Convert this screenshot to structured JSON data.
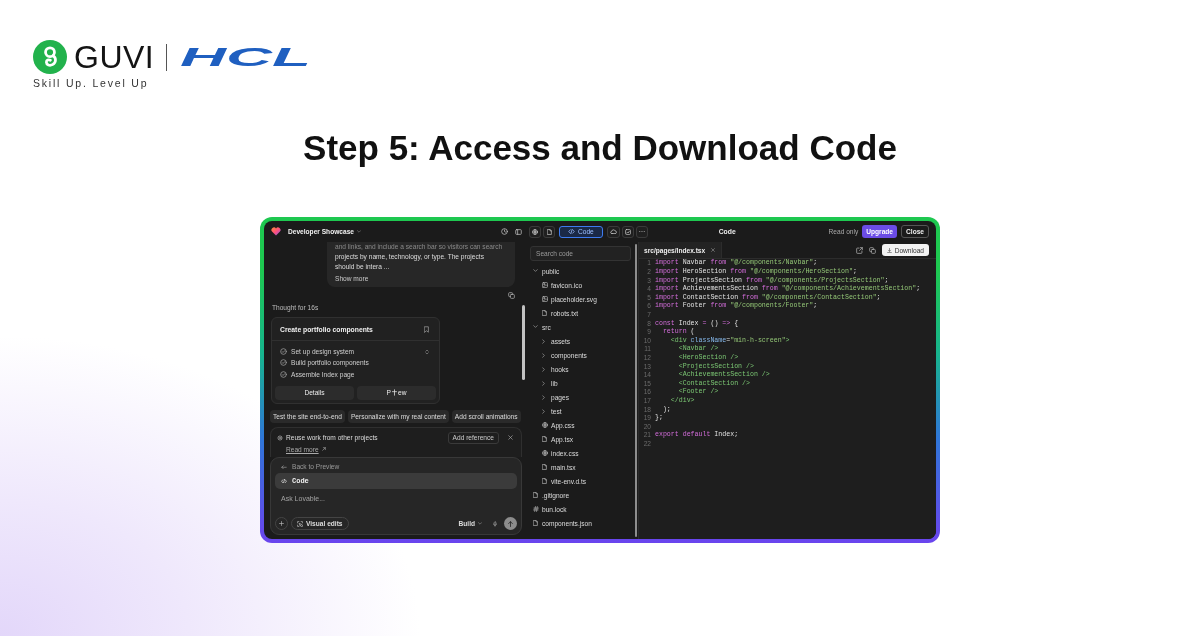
{
  "brand": {
    "name": "GUVI",
    "partner": "HCL",
    "tagline": "Skill Up. Level Up"
  },
  "heading": "Step 5: Access and Download Code",
  "app": {
    "header": {
      "project": "Developer Showcase",
      "views": [
        {
          "kind": "globe",
          "selected": false
        },
        {
          "kind": "file",
          "selected": false
        },
        {
          "kind": "code",
          "label": "Code",
          "selected": true
        },
        {
          "kind": "cloud",
          "selected": false
        },
        {
          "kind": "chart",
          "selected": false
        }
      ],
      "title": "Code",
      "status": "Read only",
      "buttons": [
        {
          "kind": "primary",
          "label": "Upgrade"
        },
        {
          "kind": "secondary",
          "label": "Close"
        }
      ]
    },
    "chat": {
      "message": {
        "lines": [
          "and links, and include a search bar so visitors can search",
          "projects by name, technology, or type. The projects",
          "should be intera ..."
        ],
        "more": "Show more"
      },
      "thought": "Thought for 16s",
      "plan": {
        "title": "Create portfolio components",
        "steps": [
          {
            "label": "Set up design system",
            "done": true
          },
          {
            "label": "Build portfolio components",
            "done": true
          },
          {
            "label": "Assemble Index page",
            "done": true
          }
        ],
        "actions": [
          {
            "label": "Details"
          },
          {
            "label": "P",
            "label_after_cursor": "ew"
          }
        ]
      },
      "suggestions": [
        "Test the site end-to-end",
        "Personalize with my real content",
        "Add scroll animations"
      ],
      "reference": {
        "text": "Reuse work from other projects",
        "link": "Read more",
        "button": "Add reference"
      },
      "composer": {
        "menu": [
          {
            "kind": "back",
            "label": "Back to Preview",
            "selected": false
          },
          {
            "kind": "code",
            "label": "Code",
            "selected": true
          }
        ],
        "placeholder": "Ask Lovable...",
        "visual_edits": "Visual edits",
        "mode": "Build"
      }
    },
    "files": {
      "search": {
        "placeholder": "Search code"
      },
      "tree": [
        {
          "label": "public",
          "kind": "folder",
          "expanded": true,
          "children": [
            {
              "label": "favicon.ico",
              "kind": "image"
            },
            {
              "label": "placeholder.svg",
              "kind": "image"
            },
            {
              "label": "robots.txt",
              "kind": "file"
            }
          ]
        },
        {
          "label": "src",
          "kind": "folder",
          "expanded": true,
          "children": [
            {
              "label": "assets",
              "kind": "folder",
              "expanded": false
            },
            {
              "label": "components",
              "kind": "folder",
              "expanded": false
            },
            {
              "label": "hooks",
              "kind": "folder",
              "expanded": false
            },
            {
              "label": "lib",
              "kind": "folder",
              "expanded": false
            },
            {
              "label": "pages",
              "kind": "folder",
              "expanded": false
            },
            {
              "label": "test",
              "kind": "folder",
              "expanded": false
            },
            {
              "label": "App.css",
              "kind": "style"
            },
            {
              "label": "App.tsx",
              "kind": "file"
            },
            {
              "label": "index.css",
              "kind": "style"
            },
            {
              "label": "main.tsx",
              "kind": "file"
            },
            {
              "label": "vite-env.d.ts",
              "kind": "file"
            }
          ]
        },
        {
          "label": ".gitignore",
          "kind": "file"
        },
        {
          "label": "bun.lock",
          "kind": "lock"
        },
        {
          "label": "components.json",
          "kind": "file"
        }
      ]
    },
    "editor": {
      "tab": "src/pages/Index.tsx",
      "download": "Download",
      "lines": [
        {
          "number": "1",
          "tokens": [
            {
              "kind": "keyword",
              "text": "import"
            },
            {
              "kind": "plain",
              "text": " Navbar "
            },
            {
              "kind": "keyword",
              "text": "from"
            },
            {
              "kind": "string",
              "text": " \"@/components/Navbar\""
            },
            {
              "kind": "plain",
              "text": ";"
            }
          ]
        },
        {
          "number": "2",
          "tokens": [
            {
              "kind": "keyword",
              "text": "import"
            },
            {
              "kind": "plain",
              "text": " HeroSection "
            },
            {
              "kind": "keyword",
              "text": "from"
            },
            {
              "kind": "string",
              "text": " \"@/components/HeroSection\""
            },
            {
              "kind": "plain",
              "text": ";"
            }
          ]
        },
        {
          "number": "3",
          "tokens": [
            {
              "kind": "keyword",
              "text": "import"
            },
            {
              "kind": "plain",
              "text": " ProjectsSection "
            },
            {
              "kind": "keyword",
              "text": "from"
            },
            {
              "kind": "string",
              "text": " \"@/components/ProjectsSection\""
            },
            {
              "kind": "plain",
              "text": ";"
            }
          ]
        },
        {
          "number": "4",
          "tokens": [
            {
              "kind": "keyword",
              "text": "import"
            },
            {
              "kind": "plain",
              "text": " AchievementsSection "
            },
            {
              "kind": "keyword",
              "text": "from"
            },
            {
              "kind": "string",
              "text": " \"@/components/AchievementsSection\""
            },
            {
              "kind": "plain",
              "text": ";"
            }
          ]
        },
        {
          "number": "5",
          "tokens": [
            {
              "kind": "keyword",
              "text": "import"
            },
            {
              "kind": "plain",
              "text": " ContactSection "
            },
            {
              "kind": "keyword",
              "text": "from"
            },
            {
              "kind": "string",
              "text": " \"@/components/ContactSection\""
            },
            {
              "kind": "plain",
              "text": ";"
            }
          ]
        },
        {
          "number": "6",
          "tokens": [
            {
              "kind": "keyword",
              "text": "import"
            },
            {
              "kind": "plain",
              "text": " Footer "
            },
            {
              "kind": "keyword",
              "text": "from"
            },
            {
              "kind": "string",
              "text": " \"@/components/Footer\""
            },
            {
              "kind": "plain",
              "text": ";"
            }
          ]
        },
        {
          "number": "7"
        },
        {
          "number": "8",
          "tokens": [
            {
              "kind": "keyword",
              "text": "const"
            },
            {
              "kind": "plain",
              "text": " Index "
            },
            {
              "kind": "keyword",
              "text": "="
            },
            {
              "kind": "plain",
              "text": " () "
            },
            {
              "kind": "keyword",
              "text": "=>"
            },
            {
              "kind": "plain",
              "text": " {"
            }
          ]
        },
        {
          "number": "9",
          "tokens": [
            {
              "kind": "keyword",
              "text": "  return"
            },
            {
              "kind": "plain",
              "text": " ("
            }
          ]
        },
        {
          "number": "10",
          "tokens": [
            {
              "kind": "tag",
              "text": "    <div"
            },
            {
              "kind": "attribute",
              "text": " className"
            },
            {
              "kind": "plain",
              "text": "="
            },
            {
              "kind": "string",
              "text": "\"min-h-screen\""
            },
            {
              "kind": "tag",
              "text": ">"
            }
          ]
        },
        {
          "number": "11",
          "tokens": [
            {
              "kind": "tag",
              "text": "      <Navbar />"
            }
          ]
        },
        {
          "number": "12",
          "tokens": [
            {
              "kind": "tag",
              "text": "      <HeroSection />"
            }
          ]
        },
        {
          "number": "13",
          "tokens": [
            {
              "kind": "tag",
              "text": "      <ProjectsSection />"
            }
          ]
        },
        {
          "number": "14",
          "tokens": [
            {
              "kind": "tag",
              "text": "      <AchievementsSection />"
            }
          ]
        },
        {
          "number": "15",
          "tokens": [
            {
              "kind": "tag",
              "text": "      <ContactSection />"
            }
          ]
        },
        {
          "number": "16",
          "tokens": [
            {
              "kind": "tag",
              "text": "      <Footer />"
            }
          ]
        },
        {
          "number": "17",
          "tokens": [
            {
              "kind": "tag",
              "text": "    </div>"
            }
          ]
        },
        {
          "number": "18",
          "tokens": [
            {
              "kind": "plain",
              "text": "  );"
            }
          ]
        },
        {
          "number": "19",
          "tokens": [
            {
              "kind": "plain",
              "text": "};"
            }
          ]
        },
        {
          "number": "20"
        },
        {
          "number": "21",
          "tokens": [
            {
              "kind": "keyword",
              "text": "export default"
            },
            {
              "kind": "plain",
              "text": " Index;"
            }
          ]
        },
        {
          "number": "22"
        }
      ]
    }
  }
}
